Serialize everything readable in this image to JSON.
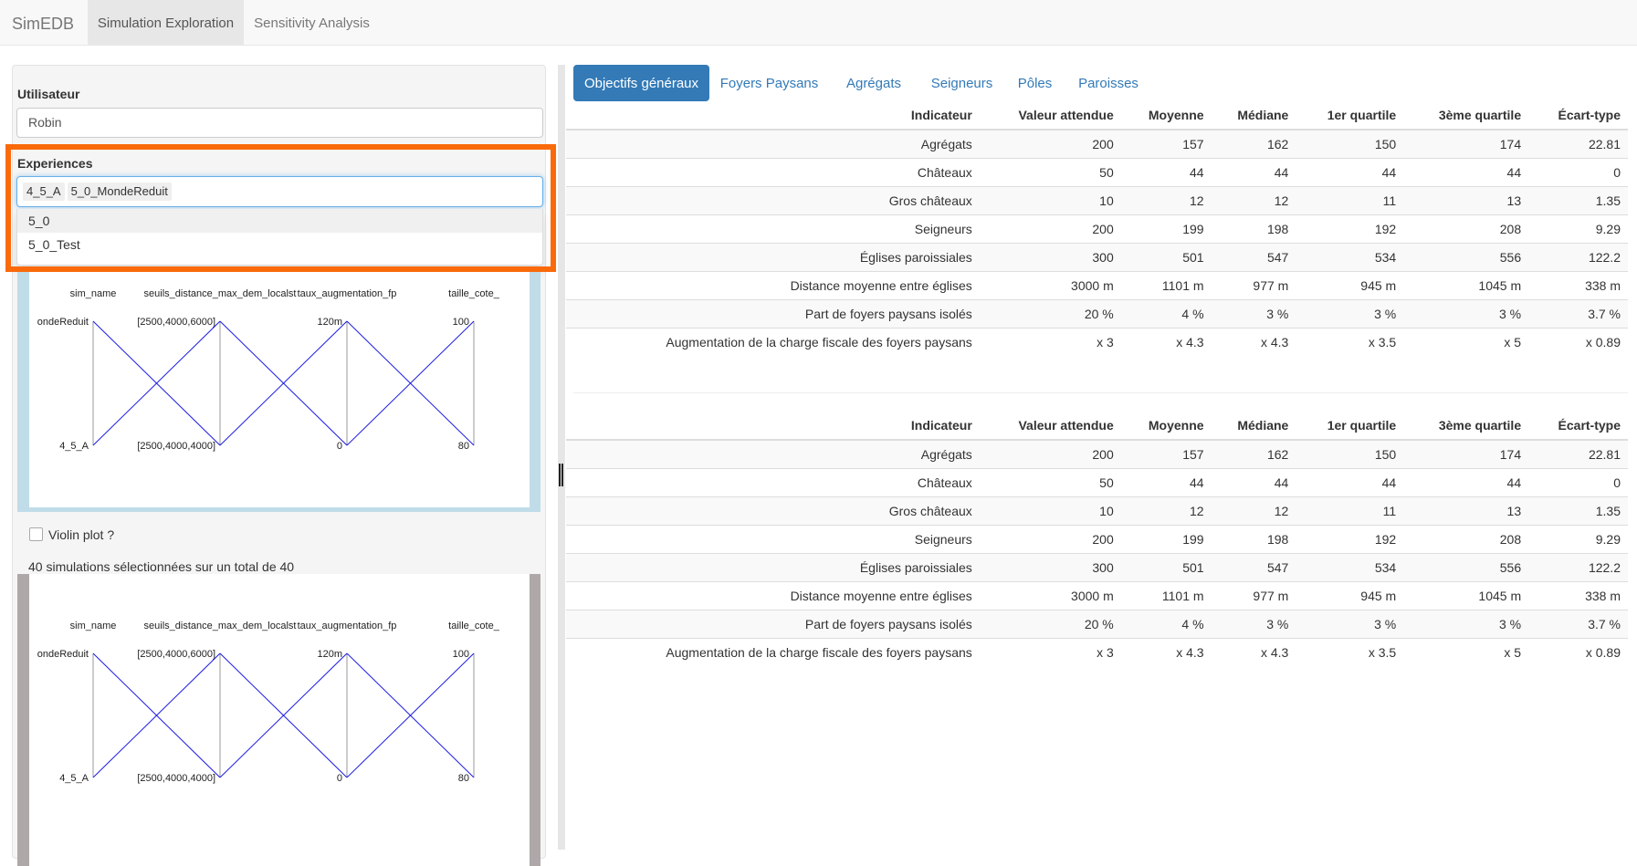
{
  "navbar": {
    "brand": "SimEDB",
    "tabs": [
      "Simulation Exploration",
      "Sensitivity Analysis"
    ],
    "active_tab": "Simulation Exploration"
  },
  "sidebar": {
    "user_label": "Utilisateur",
    "user_value": "Robin",
    "experiences_label": "Experiences",
    "selected_experiences": [
      "4_5_A",
      "5_0_MondeReduit"
    ],
    "dropdown_options": [
      "5_0",
      "5_0_Test"
    ],
    "highlighted_option": "5_0",
    "violin_label": "Violin plot ?",
    "violin_checked": false,
    "count_text": "40 simulations sélectionnées sur un total de 40"
  },
  "parcoords": {
    "line_color": "#1a1ae0",
    "axes": [
      {
        "name": "sim_name",
        "top": "ondeReduit",
        "bottom": "4_5_A"
      },
      {
        "name": "seuils_distance_max_dem_localst",
        "top": "[2500,4000,6000]",
        "bottom": "[2500,4000,4000]"
      },
      {
        "name": "taux_augmentation_fp",
        "top": "120m",
        "bottom": "0"
      },
      {
        "name": "taille_cote_",
        "top": "100",
        "bottom": "80"
      }
    ]
  },
  "main": {
    "tabs": [
      "Objectifs généraux",
      "Foyers Paysans",
      "Agrégats",
      "Seigneurs",
      "Pôles",
      "Paroisses"
    ],
    "active_tab": "Objectifs généraux",
    "columns": [
      "Indicateur",
      "Valeur attendue",
      "Moyenne",
      "Médiane",
      "1er quartile",
      "3ème quartile",
      "Écart-type"
    ],
    "tables": [
      {
        "rows": [
          [
            "Agrégats",
            "200",
            "157",
            "162",
            "150",
            "174",
            "22.81"
          ],
          [
            "Châteaux",
            "50",
            "44",
            "44",
            "44",
            "44",
            "0"
          ],
          [
            "Gros châteaux",
            "10",
            "12",
            "12",
            "11",
            "13",
            "1.35"
          ],
          [
            "Seigneurs",
            "200",
            "199",
            "198",
            "192",
            "208",
            "9.29"
          ],
          [
            "Églises paroissiales",
            "300",
            "501",
            "547",
            "534",
            "556",
            "122.2"
          ],
          [
            "Distance moyenne entre églises",
            "3000 m",
            "1101 m",
            "977 m",
            "945 m",
            "1045 m",
            "338 m"
          ],
          [
            "Part de foyers paysans isolés",
            "20 %",
            "4 %",
            "3 %",
            "3 %",
            "3 %",
            "3.7 %"
          ],
          [
            "Augmentation de la charge fiscale des foyers paysans",
            "x 3",
            "x 4.3",
            "x 4.3",
            "x 3.5",
            "x 5",
            "x 0.89"
          ]
        ]
      },
      {
        "rows": [
          [
            "Agrégats",
            "200",
            "157",
            "162",
            "150",
            "174",
            "22.81"
          ],
          [
            "Châteaux",
            "50",
            "44",
            "44",
            "44",
            "44",
            "0"
          ],
          [
            "Gros châteaux",
            "10",
            "12",
            "12",
            "11",
            "13",
            "1.35"
          ],
          [
            "Seigneurs",
            "200",
            "199",
            "198",
            "192",
            "208",
            "9.29"
          ],
          [
            "Églises paroissiales",
            "300",
            "501",
            "547",
            "534",
            "556",
            "122.2"
          ],
          [
            "Distance moyenne entre églises",
            "3000 m",
            "1101 m",
            "977 m",
            "945 m",
            "1045 m",
            "338 m"
          ],
          [
            "Part de foyers paysans isolés",
            "20 %",
            "4 %",
            "3 %",
            "3 %",
            "3 %",
            "3.7 %"
          ],
          [
            "Augmentation de la charge fiscale des foyers paysans",
            "x 3",
            "x 4.3",
            "x 4.3",
            "x 3.5",
            "x 5",
            "x 0.89"
          ]
        ]
      }
    ]
  }
}
